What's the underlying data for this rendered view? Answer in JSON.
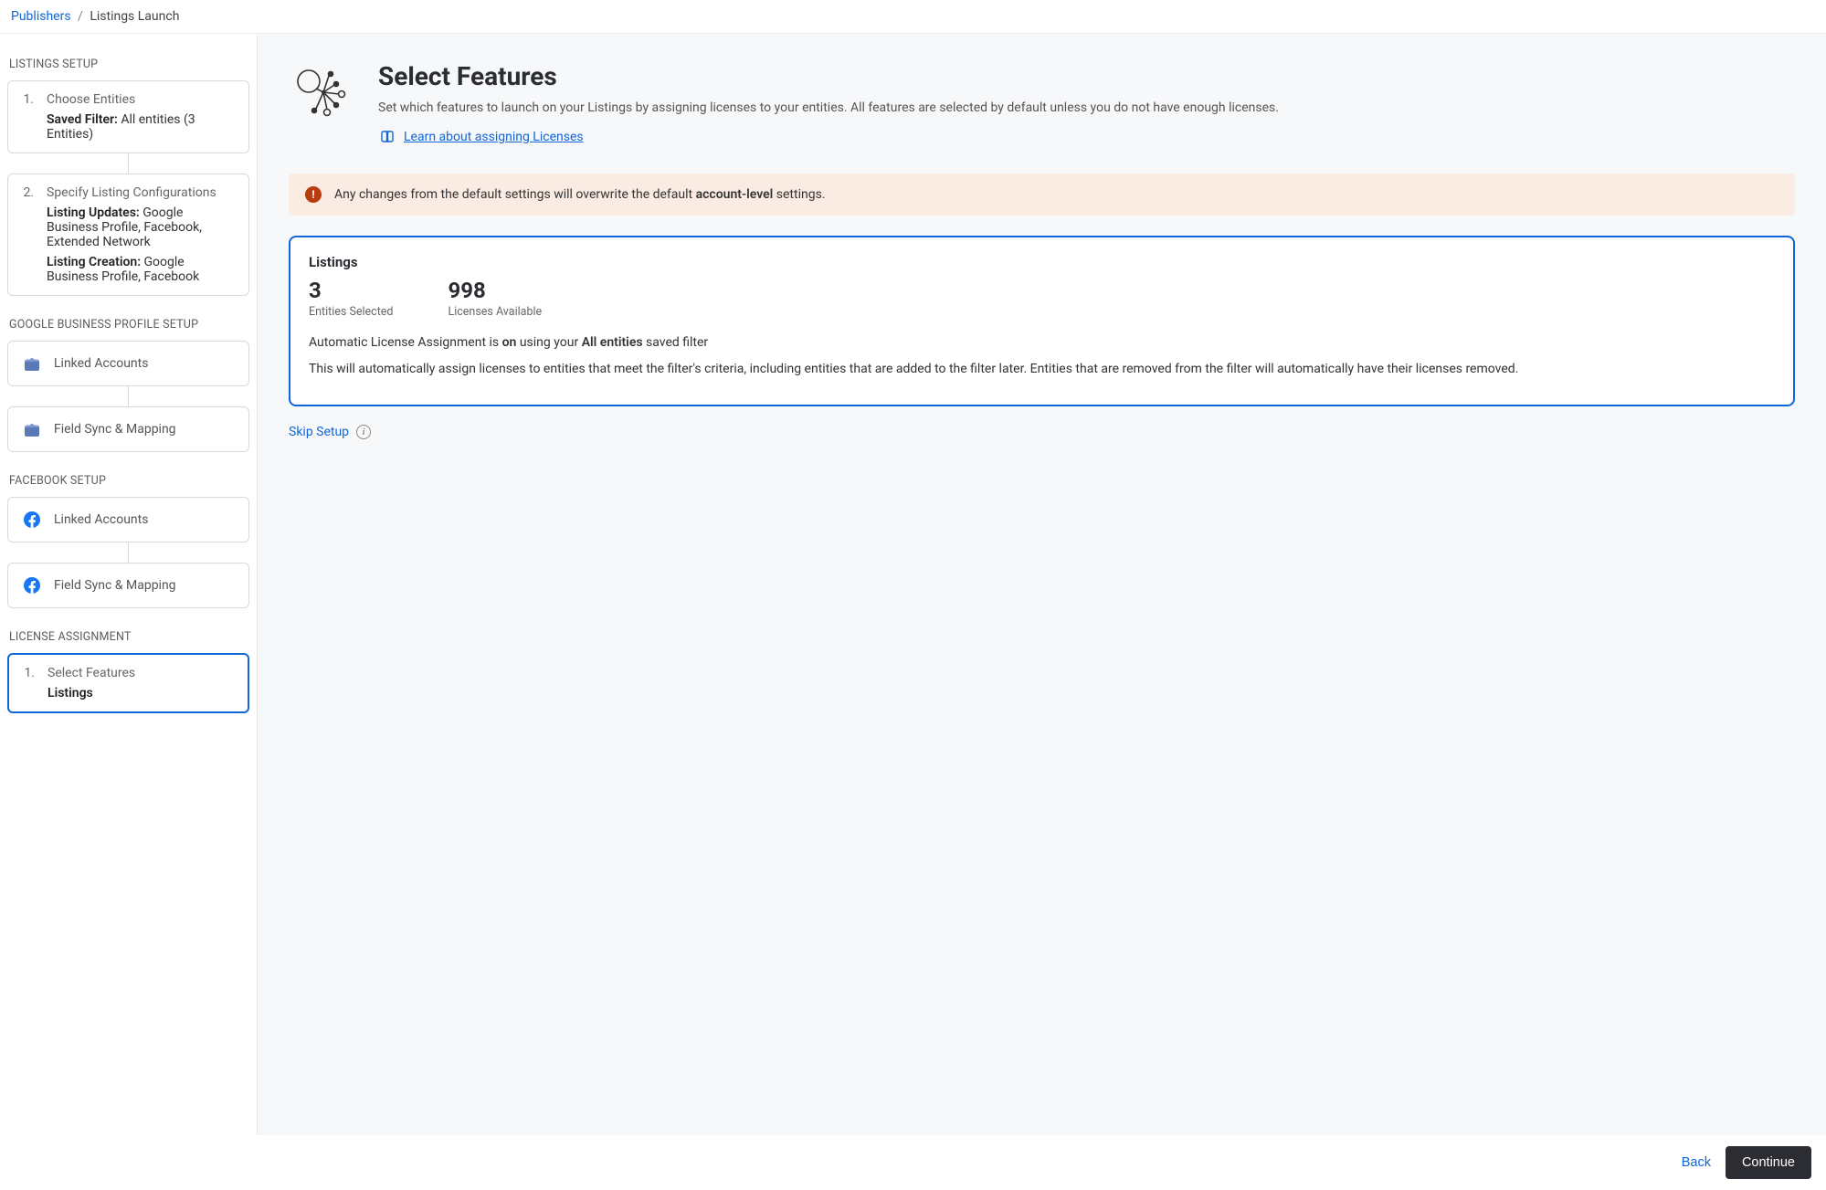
{
  "breadcrumb": {
    "parent": "Publishers",
    "current": "Listings Launch"
  },
  "sidebar": {
    "sections": {
      "listings_setup": {
        "label": "LISTINGS SETUP",
        "steps": [
          {
            "num": "1.",
            "title": "Choose Entities",
            "detail_label": "Saved Filter:",
            "detail_value": "All entities (3 Entities)"
          },
          {
            "num": "2.",
            "title": "Specify Listing Configurations",
            "lines": [
              {
                "label": "Listing Updates:",
                "value": "Google Business Profile, Facebook, Extended Network"
              },
              {
                "label": "Listing Creation:",
                "value": "Google Business Profile, Facebook"
              }
            ]
          }
        ]
      },
      "gbp_setup": {
        "label": "GOOGLE BUSINESS PROFILE SETUP",
        "items": [
          "Linked Accounts",
          "Field Sync & Mapping"
        ]
      },
      "fb_setup": {
        "label": "FACEBOOK SETUP",
        "items": [
          "Linked Accounts",
          "Field Sync & Mapping"
        ]
      },
      "license": {
        "label": "LICENSE ASSIGNMENT",
        "step_num": "1.",
        "step_title": "Select Features",
        "step_value": "Listings"
      }
    }
  },
  "main": {
    "title": "Select Features",
    "description": "Set which features to launch on your Listings by assigning licenses to your entities. All features are selected by default unless you do not have enough licenses.",
    "learn_link": "Learn about assigning Licenses",
    "warning": {
      "pre": "Any changes from the default settings will overwrite the default ",
      "bold": "account-level",
      "post": " settings."
    },
    "card": {
      "title": "Listings",
      "entities_value": "3",
      "entities_label": "Entities Selected",
      "licenses_value": "998",
      "licenses_label": "Licenses Available",
      "line1": {
        "pre": "Automatic License Assignment is ",
        "b1": "on",
        "mid": " using your ",
        "b2": "All entities",
        "post": " saved filter"
      },
      "line2": "This will automatically assign licenses to entities that meet the filter's criteria, including entities that are added to the filter later. Entities that are removed from the filter will automatically have their licenses removed."
    },
    "skip": "Skip Setup"
  },
  "footer": {
    "back": "Back",
    "continue": "Continue"
  }
}
